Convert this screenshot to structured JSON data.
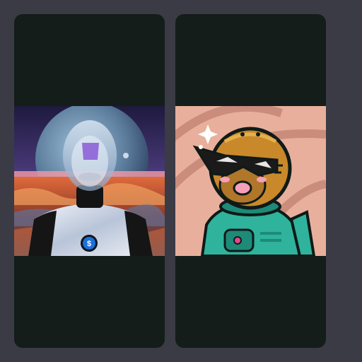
{
  "gallery": {
    "cards": [
      {
        "image": {
          "alt": "",
          "subject": "robot-astronaut-portrait",
          "badge_glyph": "$"
        }
      },
      {
        "image": {
          "alt": "",
          "subject": "cartoon-astronaut-avatar"
        }
      }
    ]
  },
  "colors": {
    "page_background": "#3a3b45",
    "card_background": "#141d1a",
    "badge_blue": "#1e6fd8",
    "suit_teal": "#2fb39c",
    "helmet_gold": "#c9892a",
    "peach_background": "#e8b09c"
  }
}
